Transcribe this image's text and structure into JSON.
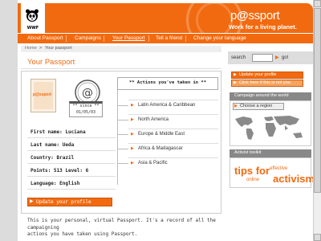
{
  "header": {
    "logo_text": "WWF",
    "brand_p": "p",
    "brand_at": "@",
    "brand_rest": "ssport",
    "tagline": "Work for a living planet."
  },
  "nav": {
    "items": [
      {
        "label": "About Passport",
        "active": false
      },
      {
        "label": "Campaigns",
        "active": false
      },
      {
        "label": "Your Passport",
        "active": true
      },
      {
        "label": "Tell a friend",
        "active": false
      },
      {
        "label": "Change your language",
        "active": false
      }
    ]
  },
  "breadcrumb": {
    "home": "Home",
    "separator": ">",
    "current": "Your passport"
  },
  "main": {
    "title": "Your Passport",
    "photo_text": "p@ssport",
    "since_label": "** since **",
    "since_date": "01/05/03",
    "actions_title": "** Actions you've taken in **",
    "regions": [
      "Latin America & Caribbean",
      "North America",
      "Europe & Middle East",
      "Africa & Madagascar",
      "Asia & Pacific"
    ],
    "info": {
      "first_name": "First name: Luciana",
      "last_name": "Last name: Ueda",
      "country": "Country: Brazil",
      "points": "Points: 513  Level: 6",
      "language": "Language: English"
    },
    "update_button": "Update your profile",
    "intro_line1": "This is your personal, virtual Passport. It's a record of all the campaigning",
    "intro_line2": "actions you have taken using Passport."
  },
  "sidebar": {
    "search_label": "search",
    "search_value": "",
    "go_label": "go!",
    "update_profile": "Update your profile",
    "not_you": "Click here if this is not you",
    "campaign_header": "Campaign around the world",
    "choose_region": "Choose a region",
    "toolkit_header": "Activist toolkit",
    "tips_text": "tips for",
    "tips_effective": "effective",
    "tips_online": "online",
    "tips_activism": "activism"
  },
  "colors": {
    "brand_orange": "#f26a10",
    "panel_gray": "#888888"
  }
}
